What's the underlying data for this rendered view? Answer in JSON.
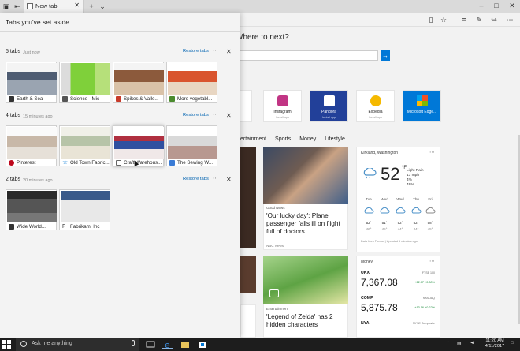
{
  "browser": {
    "tab_title": "New tab",
    "colors": {
      "accent": "#0078d7",
      "link": "#0063b1",
      "taskbar": "#1d1d1d"
    }
  },
  "aside_pane": {
    "title": "Tabs you've set aside",
    "groups": [
      {
        "count": "5 tabs",
        "time": "Just now",
        "restore": "Restore tabs",
        "tabs": [
          {
            "label": "Earth & Sea",
            "icon": "earth-sea-icon"
          },
          {
            "label": "Science - Mic",
            "icon": "science-icon"
          },
          {
            "label": "Spikes & Valle...",
            "icon": "spikes-icon"
          },
          {
            "label": "More vegetabl...",
            "icon": "vegetable-icon"
          }
        ]
      },
      {
        "count": "4 tabs",
        "time": "15 minutes ago",
        "restore": "Restore tabs",
        "tabs": [
          {
            "label": "Pinterest",
            "icon": "pinterest-icon"
          },
          {
            "label": "Old Town Fabric...",
            "icon": "star-icon"
          },
          {
            "label": "Craft Warehous...",
            "icon": "page-icon"
          },
          {
            "label": "The Sewing W...",
            "icon": "sewing-icon"
          }
        ]
      },
      {
        "count": "2 tabs",
        "time": "20 minutes ago",
        "restore": "Restore tabs",
        "tabs": [
          {
            "label": "Wide World...",
            "icon": "wide-world-icon"
          },
          {
            "label": "Fabrikam, Inc",
            "icon": "fabrikam-icon"
          }
        ]
      }
    ]
  },
  "new_tab_page": {
    "heading": "Where to next?",
    "top_sites": [
      {
        "name": "Instagram",
        "sub": "Install app",
        "color": "#c13584"
      },
      {
        "name": "Pandora",
        "sub": "Install app",
        "color": "#224099"
      },
      {
        "name": "Expedia",
        "sub": "Install app",
        "color": "#f5b900"
      },
      {
        "name": "Microsoft Edge...",
        "sub": "",
        "color": "#0078d7"
      }
    ],
    "categories": [
      "ertainment",
      "Sports",
      "Money",
      "Lifestyle"
    ],
    "news": [
      {
        "tag": "Good News",
        "headline": "'Our lucky day': Plane passenger falls ill on flight full of doctors",
        "source": "NBC News"
      },
      {
        "tag": "Entertainment",
        "headline": "'Legend of Zelda' has 2 hidden characters"
      }
    ],
    "weather": {
      "location": "Kirkland, Washington",
      "temp": "52",
      "unit": "°F",
      "condition": "Light Rain",
      "details": [
        "13 mph",
        "4%",
        "49%"
      ],
      "days": [
        {
          "day": "Tue",
          "hi": "52°",
          "lo": "46°"
        },
        {
          "day": "Wed",
          "hi": "51°",
          "lo": "45°"
        },
        {
          "day": "Wed",
          "hi": "52°",
          "lo": "44°"
        },
        {
          "day": "Thu",
          "hi": "52°",
          "lo": "44°"
        },
        {
          "day": "Fri",
          "hi": "58°",
          "lo": "45°"
        }
      ],
      "source": "Data from Foreca | Updated 6 minutes ago"
    },
    "money": {
      "title": "Money",
      "stocks": [
        {
          "name": "UKX",
          "exchange": "FTSE 100",
          "value": "7,367.08",
          "change": "+22.07 +0.30%"
        },
        {
          "name": "COMP",
          "exchange": "NASDAQ",
          "value": "5,875.78",
          "change": "+13.16 +0.22%"
        },
        {
          "name": "NYA",
          "exchange": "NYSE Composite"
        }
      ]
    }
  },
  "taskbar": {
    "search_placeholder": "Ask me anything",
    "time": "11:20 AM",
    "date": "4/11/2017"
  }
}
